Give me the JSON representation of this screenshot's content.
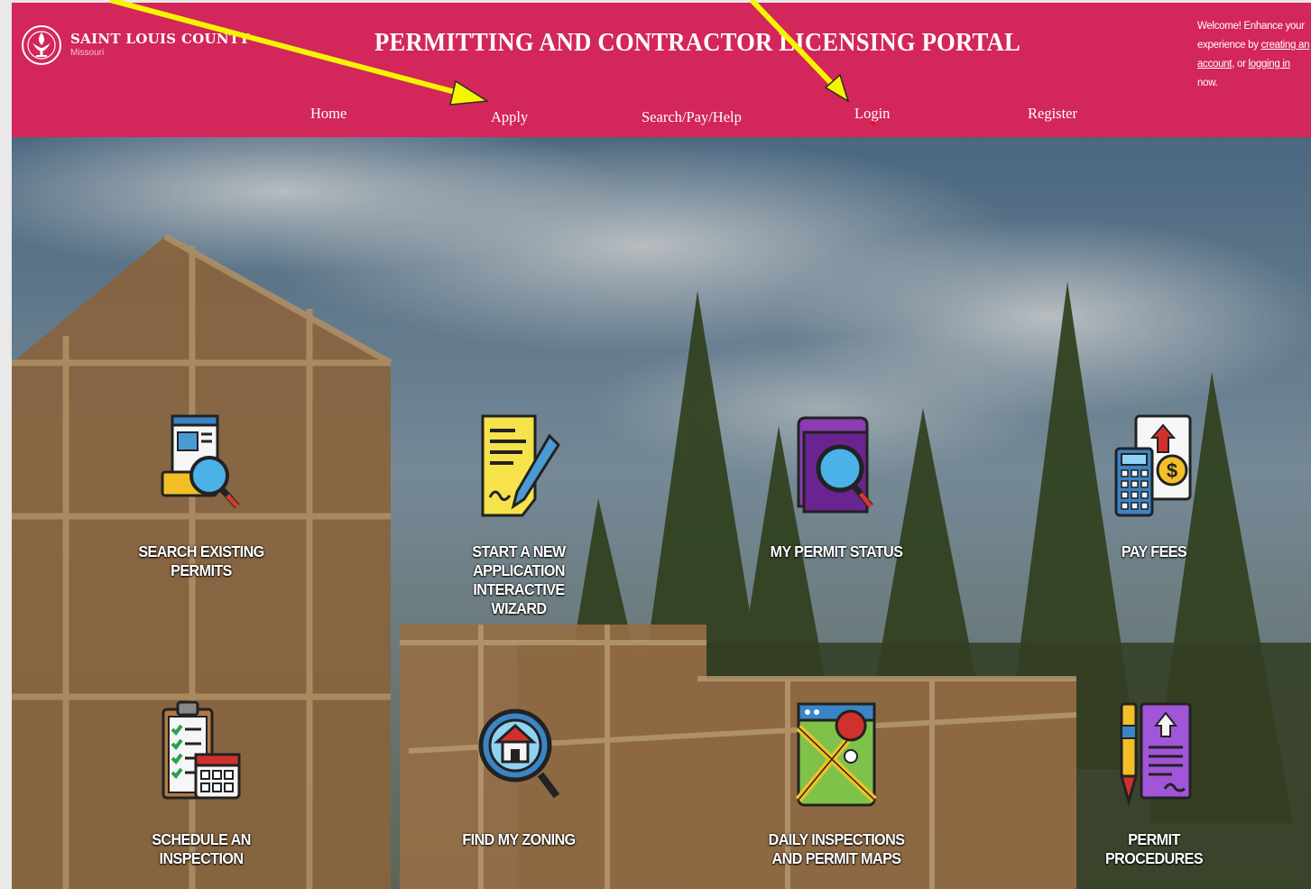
{
  "brand": {
    "name": "SAINT LOUIS COUNTY",
    "sub": "Missouri"
  },
  "header": {
    "title": "PERMITTING AND CONTRACTOR LICENSING PORTAL"
  },
  "welcome": {
    "prefix": "Welcome! Enhance your experience by ",
    "create_link": "creating an account",
    "middle": ", or ",
    "login_link": "logging in",
    "suffix": " now."
  },
  "nav": [
    {
      "label": "Home"
    },
    {
      "label": "Apply"
    },
    {
      "label": "Search/Pay/Help"
    },
    {
      "label": "Login"
    },
    {
      "label": "Register"
    }
  ],
  "tiles": [
    {
      "label": "SEARCH EXISTING PERMITS",
      "icon": "search-permits-icon"
    },
    {
      "label": "START A NEW APPLICATION INTERACTIVE WIZARD",
      "icon": "document-pen-icon"
    },
    {
      "label": "MY PERMIT STATUS",
      "icon": "folder-search-icon"
    },
    {
      "label": "PAY FEES",
      "icon": "calculator-dollar-icon"
    },
    {
      "label": "SCHEDULE AN INSPECTION",
      "icon": "clipboard-calendar-icon"
    },
    {
      "label": "FIND MY ZONING",
      "icon": "house-magnifier-icon"
    },
    {
      "label": "DAILY INSPECTIONS AND PERMIT MAPS",
      "icon": "map-pin-icon"
    },
    {
      "label": "PERMIT PROCEDURES",
      "icon": "pen-document-icon"
    }
  ],
  "colors": {
    "header": "#d3265a",
    "annotation_arrow": "#f5f500"
  }
}
